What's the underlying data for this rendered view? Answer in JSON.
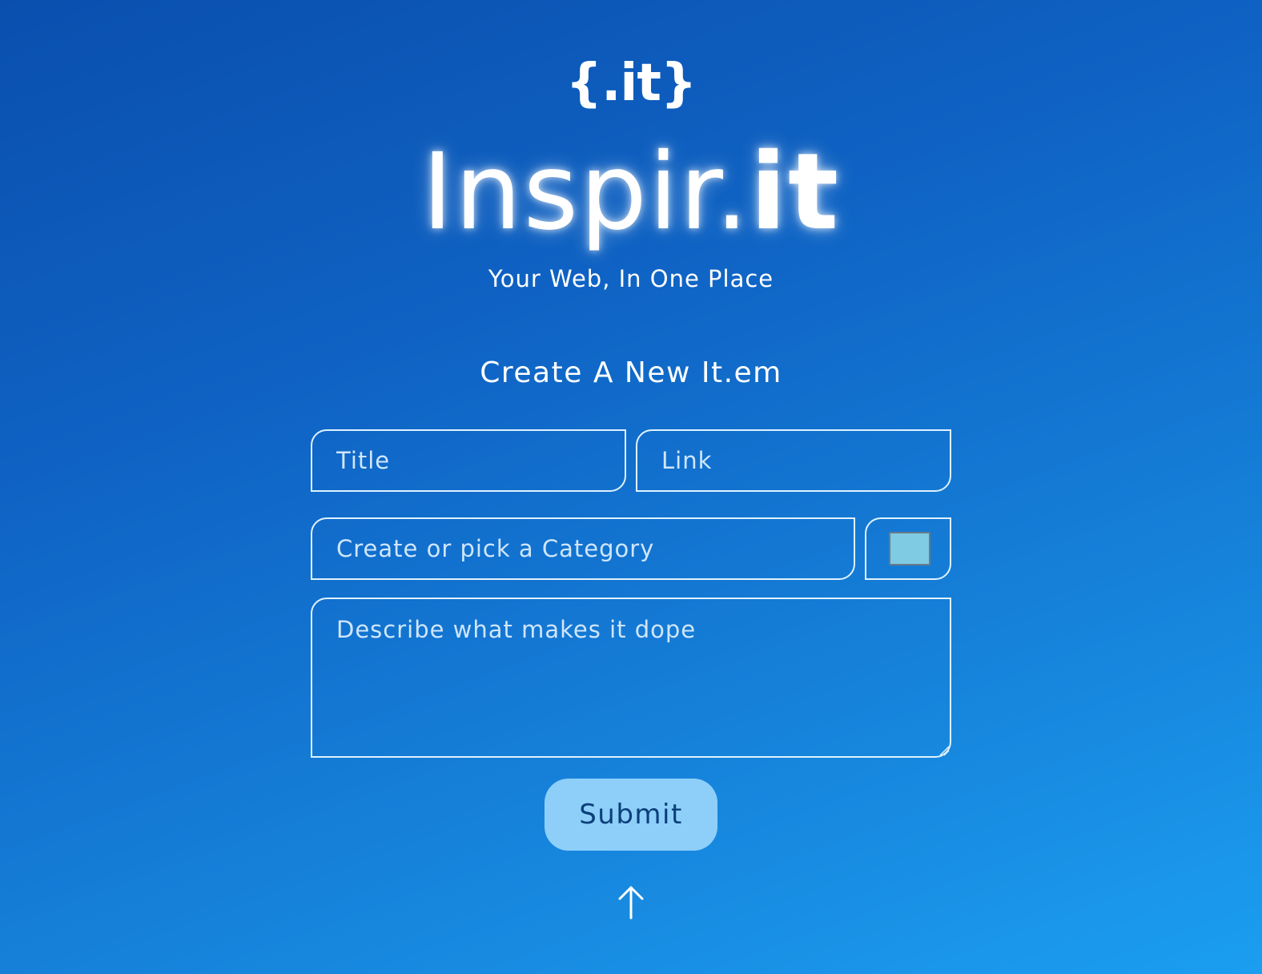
{
  "logo": {
    "text": "{.it}"
  },
  "brand": {
    "light": "Inspir.",
    "bold": "it"
  },
  "tagline": "Your Web, In One Place",
  "form": {
    "title": "Create A New It.em",
    "title_placeholder": "Title",
    "link_placeholder": "Link",
    "category_placeholder": "Create or pick a Category",
    "color_value": "#7fcbe3",
    "description_placeholder": "Describe what makes it dope",
    "submit_label": "Submit"
  },
  "icons": {
    "back_to_top": "arrow-up-icon",
    "resize": "resize-grip-icon"
  },
  "colors": {
    "background_start": "#0a4fae",
    "background_end": "#1b9ef0",
    "submit_bg": "#8ecff9",
    "submit_text": "#0b3f7a",
    "field_border": "#dff2ff"
  }
}
